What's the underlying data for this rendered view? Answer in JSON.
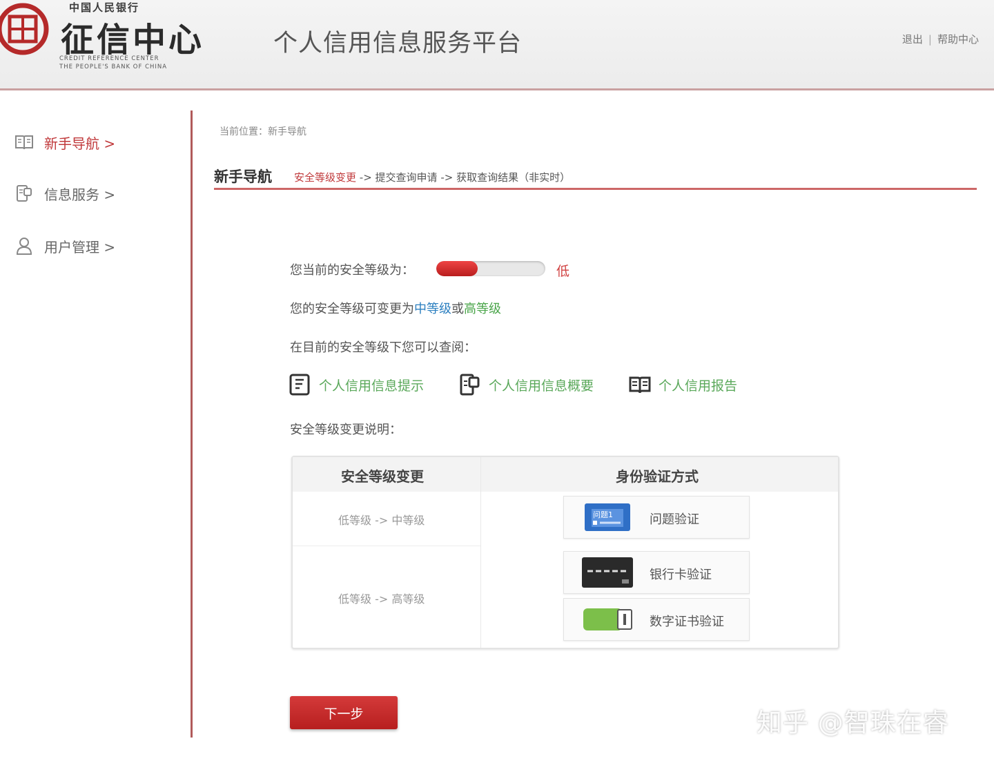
{
  "header": {
    "logo_top": "中国人民银行",
    "logo_cn": "征信中心",
    "logo_en_1": "CREDIT REFERENCE CENTER",
    "logo_en_2": "THE PEOPLE'S BANK OF CHINA",
    "platform_title": "个人信用信息服务平台",
    "links": {
      "logout": "退出",
      "separator": "|",
      "help": "帮助中心"
    }
  },
  "sidebar": {
    "items": [
      {
        "label": "新手导航 >",
        "icon": "book-icon",
        "active": true
      },
      {
        "label": "信息服务 >",
        "icon": "document-icon",
        "active": false
      },
      {
        "label": "用户管理 >",
        "icon": "user-icon",
        "active": false
      }
    ]
  },
  "breadcrumb": "当前位置：新手导航",
  "section": {
    "title": "新手导航",
    "step1": "安全等级变更",
    "arrow1": " -> ",
    "step2": "提交查询申请",
    "arrow2": " -> ",
    "step3": "获取查询结果（非实时）"
  },
  "security": {
    "current_label": "您当前的安全等级为：",
    "level_text": "低",
    "level_fraction": 0.38,
    "change_prefix": "您的安全等级可变更为",
    "mid_level": "中等级",
    "or": "或",
    "high_level": "高等级",
    "query_label": "在目前的安全等级下您可以查阅："
  },
  "queries": [
    {
      "label": "个人信用信息提示",
      "icon": "hint-doc-icon"
    },
    {
      "label": "个人信用信息概要",
      "icon": "summary-doc-icon"
    },
    {
      "label": "个人信用报告",
      "icon": "report-book-icon"
    }
  ],
  "change_note_label": "安全等级变更说明：",
  "table": {
    "headers": [
      "安全等级变更",
      "身份验证方式"
    ],
    "rows": [
      {
        "change": "低等级 -> 中等级",
        "methods": [
          {
            "label": "问题验证",
            "icon": "question-card-icon",
            "icon_text": "问题1"
          }
        ]
      },
      {
        "change": "低等级 -> 高等级",
        "methods": [
          {
            "label": "银行卡验证",
            "icon": "bank-card-icon"
          },
          {
            "label": "数字证书验证",
            "icon": "usb-key-icon"
          }
        ]
      }
    ]
  },
  "next_button": "下一步",
  "watermark": "知乎 @智珠在睿",
  "colors": {
    "brand_red": "#c0393b",
    "blue": "#2b7fc0",
    "green": "#4aa54a"
  }
}
